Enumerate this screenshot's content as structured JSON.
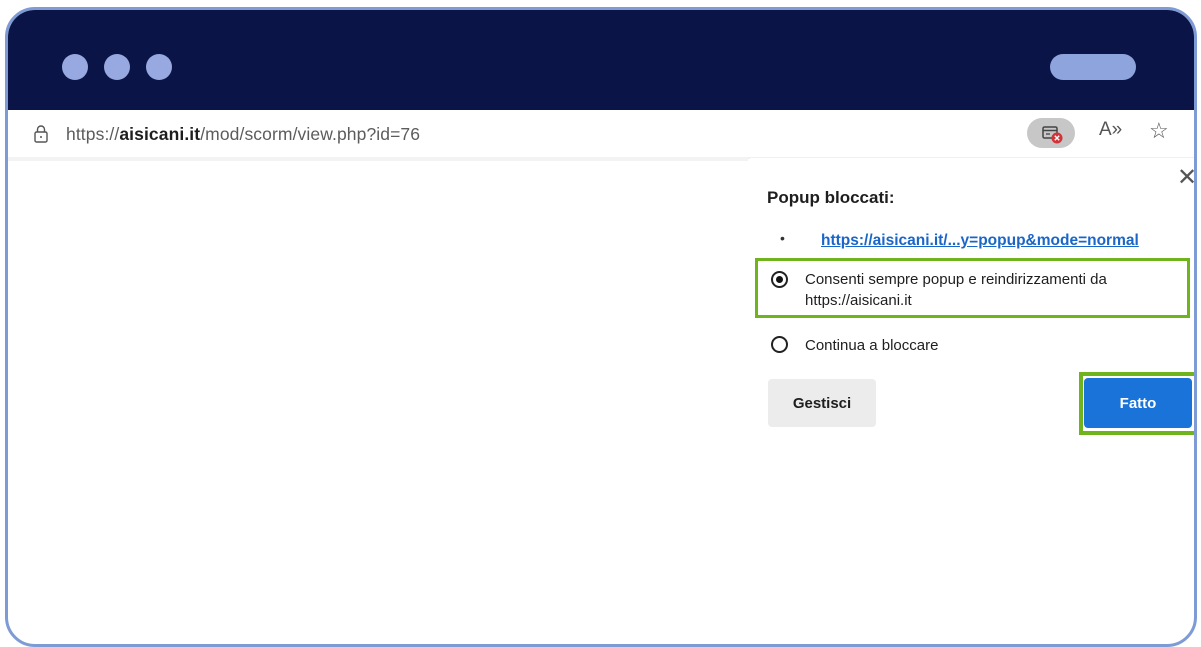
{
  "browser": {
    "url_prefix": "https://",
    "url_domain": "aisicani.it",
    "url_path": "/mod/scorm/view.php?id=76",
    "blocked_popup_icon": "popup-blocked-icon",
    "read_aloud_label": "A»",
    "favorite_icon": "star-icon"
  },
  "popup": {
    "title": "Popup bloccati:",
    "bullet": "•",
    "blocked_link": "https://aisicani.it/...y=popup&mode=normal",
    "option_allow_line1": "Consenti sempre popup e reindirizzamenti da",
    "option_allow_line2": "https://aisicani.it",
    "option_block": "Continua a bloccare",
    "selected_option": "allow",
    "manage_label": "Gestisci",
    "done_label": "Fatto",
    "close_icon": "close-icon"
  },
  "colors": {
    "titlebar": "#0b1446",
    "frame_border": "#7e9bd6",
    "highlight": "#6fb41c",
    "primary_button": "#1a73d8",
    "link": "#1a66c8"
  }
}
